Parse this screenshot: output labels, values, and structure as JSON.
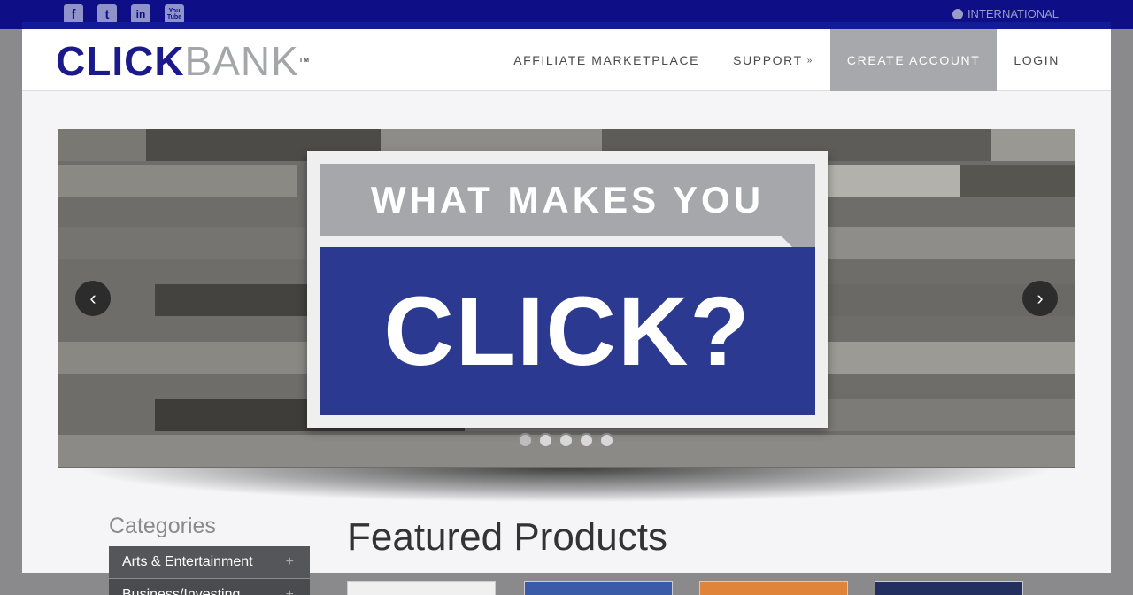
{
  "topbar": {
    "social": [
      {
        "name": "facebook-icon",
        "glyph": "f"
      },
      {
        "name": "twitter-icon",
        "glyph": "t"
      },
      {
        "name": "linkedin-icon",
        "glyph": "in"
      },
      {
        "name": "youtube-icon",
        "glyph": "You Tube"
      }
    ],
    "international_label": "INTERNATIONAL"
  },
  "logo": {
    "part1": "CLICK",
    "part2": "BANK",
    "tm": "TM"
  },
  "nav": {
    "items": [
      {
        "label": "AFFILIATE MARKETPLACE"
      },
      {
        "label": "SUPPORT",
        "caret": "»"
      },
      {
        "label": "CREATE ACCOUNT",
        "active": true
      },
      {
        "label": "LOGIN"
      }
    ]
  },
  "hero": {
    "headline_top": "WHAT MAKES YOU",
    "headline_bottom": "CLICK?",
    "prev_glyph": "‹",
    "next_glyph": "›",
    "slide_count": 5,
    "active_slide": 1
  },
  "sidebar": {
    "title": "Categories",
    "items": [
      {
        "label": "Arts & Entertainment",
        "expand": "+"
      },
      {
        "label": "Business/Investing",
        "expand": "+"
      }
    ]
  },
  "main": {
    "featured_title": "Featured Products"
  },
  "colors": {
    "brand_navy": "#0e0f86",
    "brand_grey": "#a5a6a9",
    "sign_blue": "#2b3990"
  }
}
